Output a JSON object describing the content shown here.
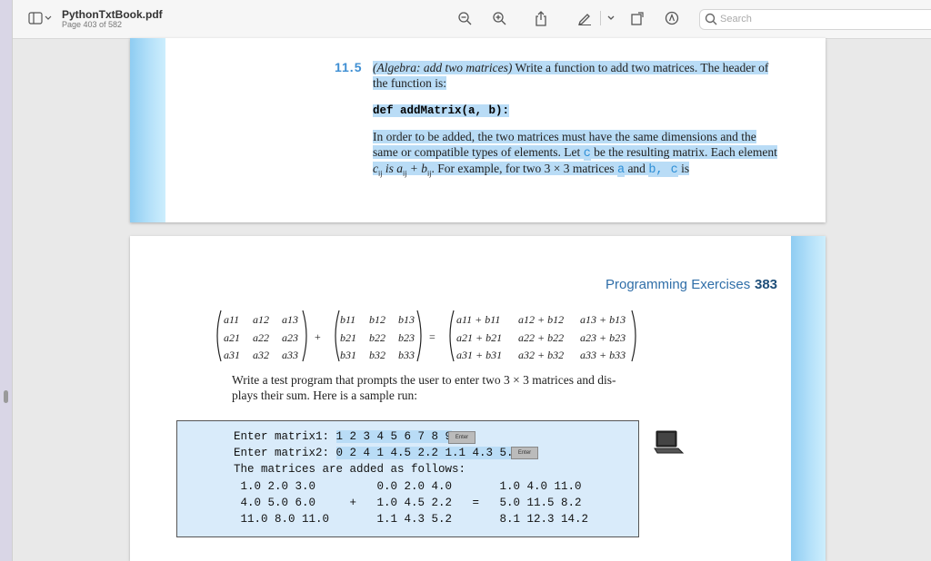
{
  "toolbar": {
    "doc_title": "PythonTxtBook.pdf",
    "page_info": "Page 403 of 582",
    "search_placeholder": "Search"
  },
  "page_top": {
    "exercise_number": "11.5",
    "exercise_title": "(Algebra: add two matrices)",
    "p1_rest_line1": " Write a function to add two matrices. The header of",
    "p1_line2": "the function is:",
    "code_header": "def addMatrix(a, b):",
    "p2_line1": "In order to be added, the two matrices must have the same dimensions and the",
    "p2_line2a": "same or compatible types of elements. Let ",
    "p2_c": "c",
    "p2_line2b": " be the resulting matrix. Each element",
    "p2_line3a": "c",
    "p2_line3_sub1": "ij",
    "p2_line3b": " is a",
    "p2_line3_sub2": "ij",
    "p2_line3c": " + b",
    "p2_line3_sub3": "ij",
    "p2_line3d": ". For example, for two 3 × 3 matrices ",
    "p2_a": "a",
    "p2_and": " and ",
    "p2_bc": "b, c",
    "p2_is": " is"
  },
  "page_bottom": {
    "section_title": "Programming Exercises",
    "page_number": "383",
    "matrix_a": [
      [
        "a11",
        "a12",
        "a13"
      ],
      [
        "a21",
        "a22",
        "a23"
      ],
      [
        "a31",
        "a32",
        "a33"
      ]
    ],
    "matrix_b": [
      [
        "b11",
        "b12",
        "b13"
      ],
      [
        "b21",
        "b22",
        "b23"
      ],
      [
        "b31",
        "b32",
        "b33"
      ]
    ],
    "matrix_sum": [
      [
        "a11 + b11",
        "a12 + b12",
        "a13 + b13"
      ],
      [
        "a21 + b21",
        "a22 + b22",
        "a23 + b23"
      ],
      [
        "a31 + b31",
        "a32 + b32",
        "a33 + b33"
      ]
    ],
    "plus": "+",
    "equals": "=",
    "text_line1": "Write a test program that prompts the user to enter two 3 × 3 matrices and dis-",
    "text_line2": "plays their sum. Here is a sample run:",
    "run": {
      "prompt1": "Enter matrix1: ",
      "input1": "1 2 3 4 5 6 7 8 9",
      "prompt2": "Enter matrix2: ",
      "input2": "0 2 4 1 4.5 2.2 1.1 4.3 5.2",
      "enter_label": "Enter",
      "line3": "The matrices are added as follows:",
      "line4": " 1.0 2.0 3.0         0.0 2.0 4.0       1.0 4.0 11.0",
      "line5": " 4.0 5.0 6.0     +   1.0 4.5 2.2   =   5.0 11.5 8.2",
      "line6": " 11.0 8.0 11.0       1.1 4.3 5.2       8.1 12.3 14.2"
    }
  }
}
